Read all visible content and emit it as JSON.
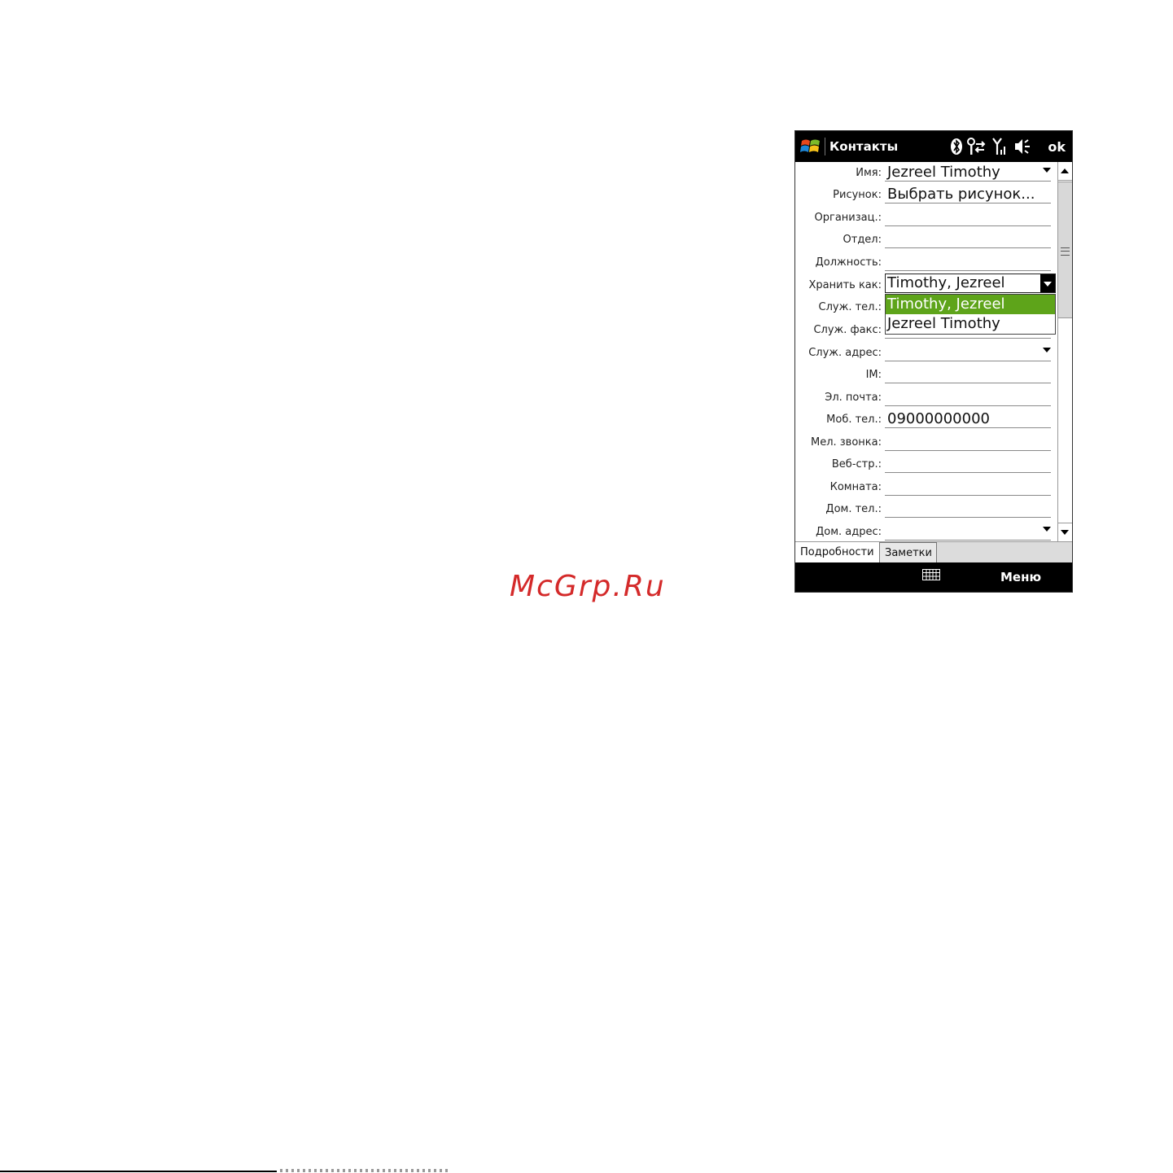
{
  "watermark": "McGrp.Ru",
  "titlebar": {
    "title": "Контакты",
    "ok_label": "ok"
  },
  "status_icons": [
    "bluetooth-icon",
    "connectivity-icon",
    "signal-icon",
    "volume-icon"
  ],
  "fields": [
    {
      "label": "Имя:",
      "value": "Jezreel Timothy",
      "has_dropdown": true
    },
    {
      "label": "Рисунок:",
      "value": "Выбрать рисунок..."
    },
    {
      "label": "Организац.:",
      "value": ""
    },
    {
      "label": "Отдел:",
      "value": ""
    },
    {
      "label": "Должность:",
      "value": ""
    },
    {
      "label": "Хранить как:",
      "value": "Timothy, Jezreel"
    },
    {
      "label": "Служ. тел.:",
      "value": ""
    },
    {
      "label": "Служ. факс:",
      "value": ""
    },
    {
      "label": "Служ. адрес:",
      "value": "",
      "has_dropdown": true
    },
    {
      "label": "IM:",
      "value": ""
    },
    {
      "label": "Эл. почта:",
      "value": ""
    },
    {
      "label": "Моб. тел.:",
      "value": "09000000000"
    },
    {
      "label": "Мел. звонка:",
      "value": ""
    },
    {
      "label": "Веб-стр.:",
      "value": ""
    },
    {
      "label": "Комната:",
      "value": ""
    },
    {
      "label": "Дом. тел.:",
      "value": ""
    },
    {
      "label": "Дом. адрес:",
      "value": "",
      "has_dropdown": true
    }
  ],
  "dropdown": {
    "options": [
      "Timothy, Jezreel",
      "Jezreel Timothy"
    ],
    "selected": "Timothy, Jezreel"
  },
  "tabs": [
    {
      "label": "Подробности",
      "active": true
    },
    {
      "label": "Заметки",
      "active": false
    }
  ],
  "softkeys": {
    "right": "Меню",
    "center_icon": "keyboard-icon"
  },
  "colors": {
    "selection": "#5ea41a",
    "bar": "#000000"
  }
}
